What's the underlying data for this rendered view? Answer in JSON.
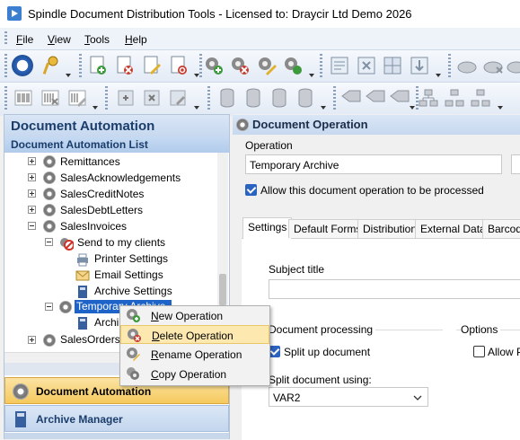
{
  "window": {
    "title": "Spindle Document Distribution Tools - Licensed to: Draycir Ltd Demo 2026"
  },
  "menu": [
    "File",
    "View",
    "Tools",
    "Help"
  ],
  "toolbar_icons_row1": [
    "info-icon",
    "key-icon",
    "add-document-icon",
    "delete-document-icon",
    "edit-document-icon",
    "refresh-document-icon",
    "add-operation-icon",
    "delete-operation-icon",
    "edit-operation-icon",
    "refresh-operation-icon",
    "form-icon",
    "form-delete-icon",
    "form-grid-icon",
    "form-import-icon",
    "cloud-icon",
    "cloud-delete-icon",
    "cloud-edit-icon"
  ],
  "toolbar_icons_row2": [
    "barcode-icon",
    "barcode-delete-icon",
    "barcode-edit-icon",
    "data-add-icon",
    "data-delete-icon",
    "data-edit-icon",
    "database-add-icon",
    "database-delete-icon",
    "database-edit-icon",
    "database-refresh-icon",
    "tag-add-icon",
    "tag-delete-icon",
    "tag-edit-icon",
    "hierarchy-add-icon",
    "hierarchy-delete-icon",
    "hierarchy-edit-icon"
  ],
  "left_panel": {
    "title": "Document Automation",
    "subtitle": "Document Automation List",
    "tree": [
      {
        "label": "Remittances"
      },
      {
        "label": "SalesAcknowledgements"
      },
      {
        "label": "SalesCreditNotes"
      },
      {
        "label": "SalesDebtLetters"
      },
      {
        "label": "SalesInvoices"
      },
      {
        "label": "Send to my clients"
      },
      {
        "label": "Printer Settings"
      },
      {
        "label": "Email Settings"
      },
      {
        "label": "Archive Settings"
      },
      {
        "label": "Temporary Archive"
      },
      {
        "label": "Archi"
      },
      {
        "label": "SalesOrders"
      }
    ],
    "nav": [
      "Document Automation",
      "Archive Manager"
    ]
  },
  "right_panel": {
    "title": "Document Operation",
    "operation_label": "Operation",
    "operation_value": "Temporary Archive",
    "allow_label": "Allow this document operation to be processed",
    "tabs": [
      "Settings",
      "Default Forms",
      "Distribution",
      "External Data",
      "Barcode"
    ],
    "subject_label": "Subject title",
    "doc_processing_label": "Document processing",
    "split_up_label": "Split up document",
    "split_using_label": "Split document using:",
    "split_using_value": "VAR2",
    "options_label": "Options",
    "allow_p_label": "Allow Pr"
  },
  "context_menu": {
    "items": [
      {
        "label": "New Operation",
        "icon": "gear-add-icon"
      },
      {
        "label": "Delete Operation",
        "icon": "gear-delete-icon",
        "highlighted": true
      },
      {
        "label": "Rename Operation",
        "icon": "gear-rename-icon"
      },
      {
        "label": "Copy Operation",
        "icon": "gear-copy-icon"
      }
    ]
  }
}
